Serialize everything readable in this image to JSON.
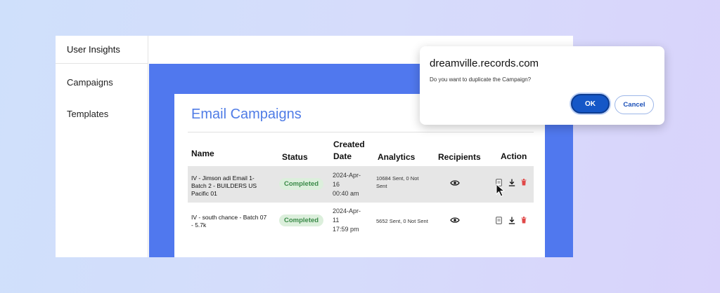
{
  "sidebar": {
    "header": "User Insights",
    "items": [
      {
        "label": "Campaigns"
      },
      {
        "label": "Templates"
      }
    ]
  },
  "main": {
    "title": "Email Campaigns",
    "columns": {
      "name": "Name",
      "status": "Status",
      "created_line1": "Created",
      "created_line2": "Date",
      "analytics": "Analytics",
      "recipients": "Recipients",
      "action": "Action"
    },
    "rows": [
      {
        "name": "IV - Jimson adi Email 1- Batch 2 - BUILDERS US Pacific 01",
        "status": "Completed",
        "date_line1": "2024-Apr-",
        "date_line2": "16",
        "date_line3": "00:40 am",
        "analytics": "10684 Sent, 0 Not Sent"
      },
      {
        "name": "IV - south chance - Batch 07 - 5.7k",
        "status": "Completed",
        "date_line1": "2024-Apr-",
        "date_line2": "11",
        "date_line3": "17:59 pm",
        "analytics": "5652 Sent, 0 Not Sent"
      }
    ]
  },
  "dialog": {
    "title": "dreamville.records.com",
    "message": "Do you want to duplicate the Campaign?",
    "ok_label": "OK",
    "cancel_label": "Cancel"
  },
  "icons": {
    "recipients": "eye-icon",
    "duplicate": "copy-icon",
    "download": "download-icon",
    "delete": "trash-icon",
    "cursor": "mouse-pointer-icon"
  },
  "colors": {
    "accent": "#5078ee",
    "title": "#4f7ce6",
    "badge_bg": "#dcefdc",
    "badge_text": "#3a8a48",
    "ok_button": "#1557c7",
    "delete_icon": "#e04848"
  }
}
